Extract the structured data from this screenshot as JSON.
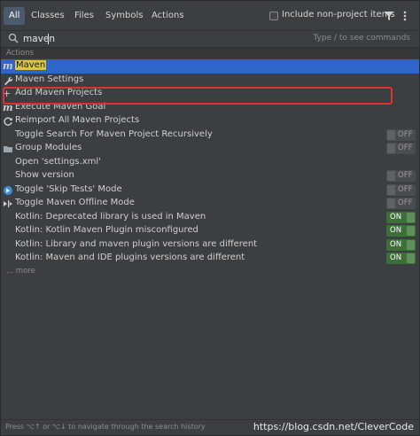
{
  "tabs": [
    {
      "label": "All",
      "active": true
    },
    {
      "label": "Classes",
      "active": false
    },
    {
      "label": "Files",
      "active": false
    },
    {
      "label": "Symbols",
      "active": false
    },
    {
      "label": "Actions",
      "active": false
    }
  ],
  "include_non_project": {
    "label": "Include non-project items",
    "checked": false
  },
  "search": {
    "value": "maven",
    "hint": "Type / to see commands"
  },
  "section": {
    "title": "Actions"
  },
  "items": [
    {
      "label": "Maven",
      "highlight": "Maven",
      "icon": "maven-icon",
      "selected": true,
      "toggle": ""
    },
    {
      "label": "Maven Settings",
      "icon": "wrench-icon",
      "selected": false,
      "toggle": ""
    },
    {
      "label": "Add Maven Projects",
      "icon": "plus-icon",
      "selected": false,
      "toggle": ""
    },
    {
      "label": "Execute Maven Goal",
      "icon": "maven-icon",
      "selected": false,
      "toggle": ""
    },
    {
      "label": "Reimport All Maven Projects",
      "icon": "refresh-icon",
      "selected": false,
      "toggle": ""
    },
    {
      "label": "Toggle Search For Maven Project Recursively",
      "icon": "",
      "selected": false,
      "toggle": "OFF"
    },
    {
      "label": "Group Modules",
      "icon": "folder-icon",
      "selected": false,
      "toggle": "OFF"
    },
    {
      "label": "Open 'settings.xml'",
      "icon": "",
      "selected": false,
      "toggle": ""
    },
    {
      "label": "Show version",
      "icon": "",
      "selected": false,
      "toggle": "OFF"
    },
    {
      "label": "Toggle 'Skip Tests' Mode",
      "icon": "skip-tests-icon",
      "selected": false,
      "toggle": "OFF"
    },
    {
      "label": "Toggle Maven Offline Mode",
      "icon": "offline-icon",
      "selected": false,
      "toggle": "OFF"
    },
    {
      "label": "Kotlin: Deprecated library is used in Maven",
      "icon": "",
      "selected": false,
      "toggle": "ON"
    },
    {
      "label": "Kotlin: Kotlin Maven Plugin misconfigured",
      "icon": "",
      "selected": false,
      "toggle": "ON"
    },
    {
      "label": "Kotlin: Library and maven plugin versions are different",
      "icon": "",
      "selected": false,
      "toggle": "ON"
    },
    {
      "label": "Kotlin: Maven and IDE plugins versions are different",
      "icon": "",
      "selected": false,
      "toggle": "ON"
    }
  ],
  "more_label": "... more",
  "footer": {
    "nav_hint": "Press ⌥↑ or ⌥↓ to navigate through the search history",
    "watermark": "https://blog.csdn.net/CleverCode"
  },
  "colors": {
    "selection": "#2f65ca",
    "highlight": "#d9c64a",
    "annotation": "#e03131",
    "toggle_on": "#3e6e3a"
  }
}
